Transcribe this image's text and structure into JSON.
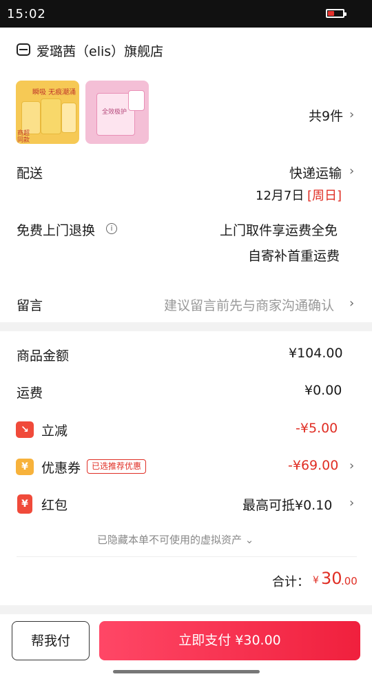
{
  "status": {
    "time": "15:02",
    "battery_level": 0.45,
    "battery_color": "#e5322d"
  },
  "shop": {
    "name": "爱璐茜（elis）旗舰店",
    "icon": "shop-icon"
  },
  "products": {
    "thumb1": {
      "line1": "瞬吸 无痕潮涌",
      "tag": "商超同款"
    },
    "thumb2": {
      "text": "全效极护"
    },
    "count": "共9件"
  },
  "delivery": {
    "label": "配送",
    "method": "快递运输",
    "date": "12月7日",
    "day": "[周日]"
  },
  "returns": {
    "label": "免费上门退换",
    "line1": "上门取件享运费全免",
    "line2": "自寄补首重运费"
  },
  "message": {
    "label": "留言",
    "placeholder": "建议留言前先与商家沟通确认"
  },
  "pricing": {
    "goods_label": "商品金额",
    "goods_value": "¥104.00",
    "shipping_label": "运费",
    "shipping_value": "¥0.00",
    "discount_label": "立减",
    "discount_value": "-¥5.00",
    "coupon_label": "优惠券",
    "coupon_tag": "已选推荐优惠",
    "coupon_value": "-¥69.00",
    "redpacket_label": "红包",
    "redpacket_value": "最高可抵¥0.10"
  },
  "hidden_assets": "已隐藏本单不可使用的虚拟资产",
  "total": {
    "label": "合计：",
    "currency": "¥",
    "integer": "30",
    "decimal": ".00"
  },
  "footer": {
    "help_label": "帮我付",
    "pay_label": "立即支付 ¥30.00"
  },
  "colors": {
    "accent": "#e02e24",
    "pay_button": "#f0203d",
    "discount_icon": "#f04a3a",
    "coupon_icon": "#f7b23b"
  },
  "icons": {
    "discount": "down-arrow-icon",
    "coupon": "yuan-coupon-icon",
    "redpacket": "red-packet-icon"
  }
}
